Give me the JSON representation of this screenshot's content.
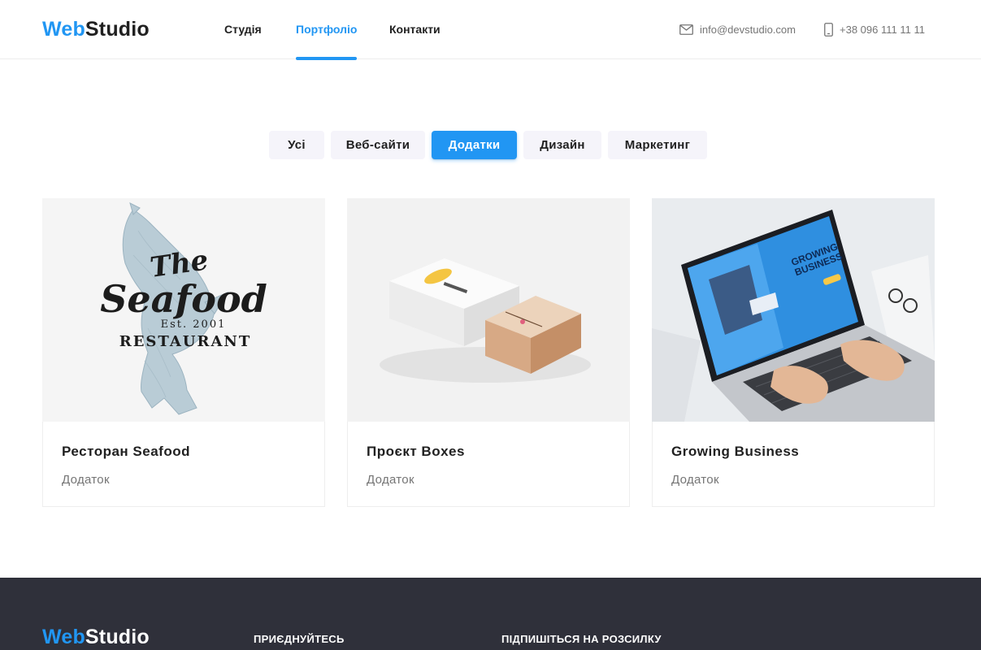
{
  "header": {
    "logo_part1": "Web",
    "logo_part2": "Studio",
    "nav": [
      "Студія",
      "Портфоліо",
      "Контакти"
    ],
    "active_nav": "Портфоліо",
    "email": "info@devstudio.com",
    "phone": "+38 096 111 11 11"
  },
  "filters": {
    "items": [
      "Усі",
      "Веб-сайти",
      "Додатки",
      "Дизайн",
      "Маркетинг"
    ],
    "active": "Додатки"
  },
  "cards": [
    {
      "title": "Ресторан Seafood",
      "category": "Додаток",
      "image": "seafood-logo"
    },
    {
      "title": "Проєкт Boxes",
      "category": "Додаток",
      "image": "boxes-mockup"
    },
    {
      "title": "Growing Business",
      "category": "Додаток",
      "image": "laptop-photo"
    }
  ],
  "thumb_text": {
    "seafood_the": "The",
    "seafood_word": "Seafood",
    "seafood_est": "Est. 2001",
    "seafood_restaurant": "RESTAURANT",
    "laptop_headline1": "GROWING",
    "laptop_headline2": "BUSINESS"
  },
  "footer": {
    "logo_part1": "Web",
    "logo_part2": "Studio",
    "join_title": "ПРИЄДНУЙТЕСЬ",
    "subscribe_title": "ПІДПИШІТЬСЯ НА РОЗСИЛКУ"
  },
  "colors": {
    "accent": "#2196f3",
    "text": "#212121",
    "muted": "#757575",
    "filter_bg": "#f5f4fa",
    "footer_bg": "#2f303a"
  }
}
